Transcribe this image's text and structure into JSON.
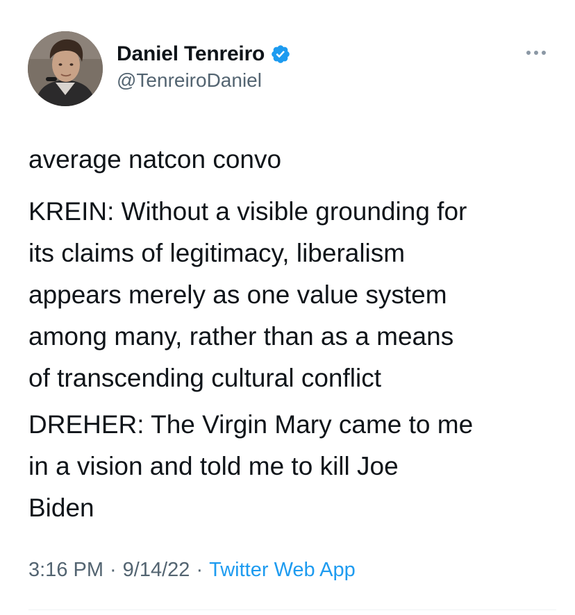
{
  "tweet": {
    "author": {
      "display_name": "Daniel Tenreiro",
      "handle": "@TenreiroDaniel",
      "verified": true,
      "avatar_icon": "profile-photo"
    },
    "more_icon": "more-horizontal-icon",
    "paragraphs": [
      "average natcon convo",
      "KREIN: Without a visible grounding for\nits claims of legitimacy, liberalism\nappears merely as one value system\namong many, rather than as a means\nof transcending cultural conflict",
      "DREHER: The Virgin Mary came to me\nin a vision and told me to kill Joe\nBiden"
    ],
    "meta": {
      "time": "3:16 PM",
      "separator": "·",
      "date": "9/14/22",
      "source": "Twitter Web App"
    }
  },
  "colors": {
    "text_primary": "#0f1419",
    "text_secondary": "#536471",
    "accent": "#1d9bf0"
  }
}
